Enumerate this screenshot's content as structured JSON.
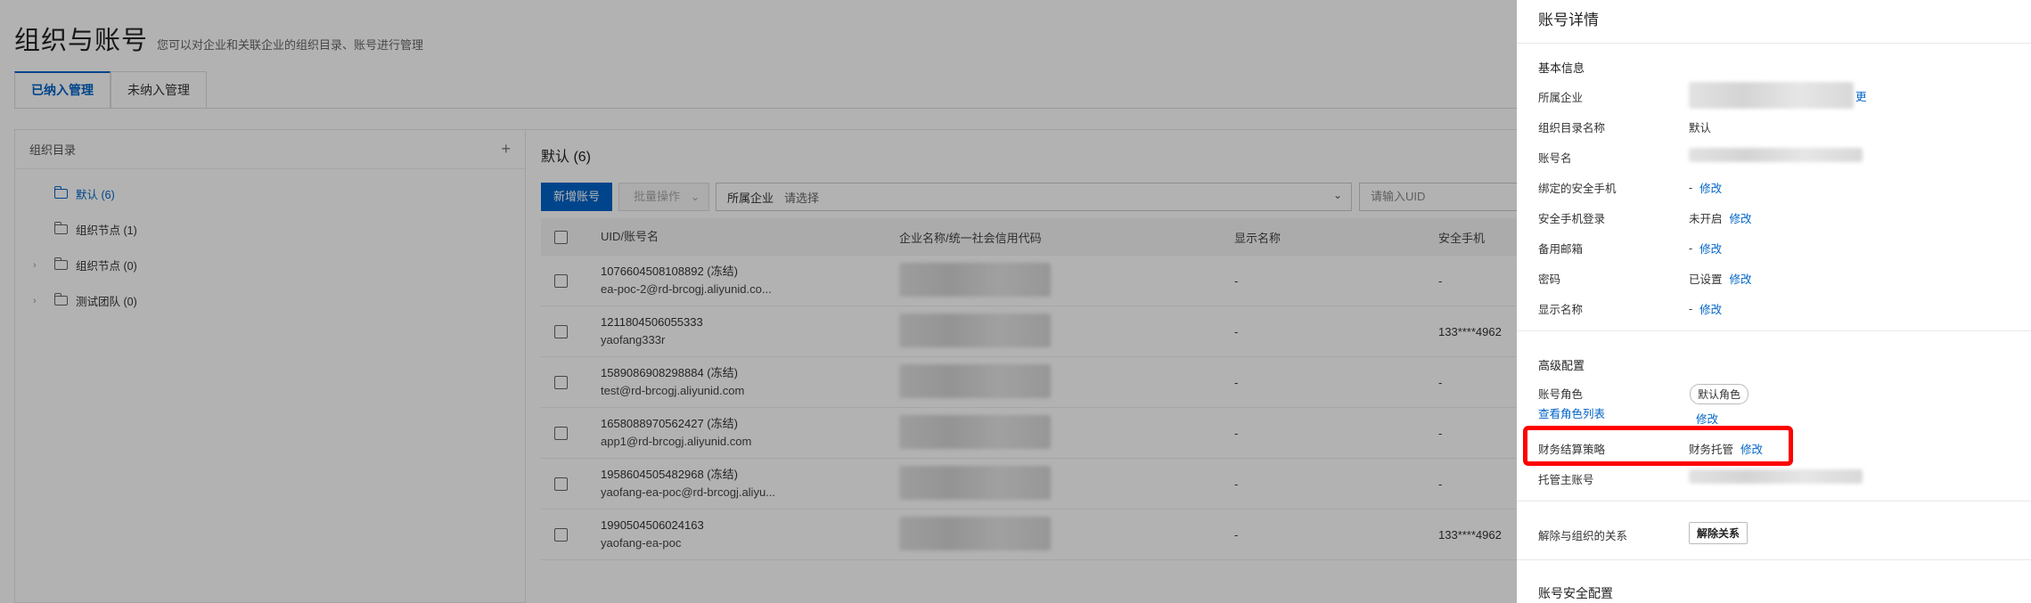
{
  "page": {
    "title": "组织与账号",
    "subtitle": "您可以对企业和关联企业的组织目录、账号进行管理",
    "tabs": [
      "已纳入管理",
      "未纳入管理"
    ]
  },
  "tree": {
    "title": "组织目录",
    "add_symbol": "+",
    "items": [
      {
        "label": "默认 (6)",
        "selected": true,
        "expandable": false
      },
      {
        "label": "组织节点 (1)",
        "selected": false,
        "expandable": false
      },
      {
        "label": "组织节点 (0)",
        "selected": false,
        "expandable": true
      },
      {
        "label": "测试团队 (0)",
        "selected": false,
        "expandable": true
      }
    ]
  },
  "main": {
    "title": "默认 (6)",
    "new_account_label": "新增账号",
    "batch_label": "批量操作",
    "enterprise_select_label": "所属企业",
    "enterprise_select_placeholder": "请选择",
    "uid_input_placeholder": "请输入UID",
    "columns": [
      "UID/账号名",
      "企业名称/统一社会信用代码",
      "显示名称",
      "安全手机"
    ],
    "rows": [
      {
        "uid": "1076604508108892 (冻结)",
        "account": "ea-poc-2@rd-brcogj.aliyunid.co...",
        "display": "-",
        "phone": "-"
      },
      {
        "uid": "1211804506055333",
        "account": "yaofang333r",
        "display": "-",
        "phone": "133****4962"
      },
      {
        "uid": "1589086908298884 (冻结)",
        "account": "test@rd-brcogj.aliyunid.com",
        "display": "-",
        "phone": "-"
      },
      {
        "uid": "1658088970562427 (冻结)",
        "account": "app1@rd-brcogj.aliyunid.com",
        "display": "-",
        "phone": "-"
      },
      {
        "uid": "1958604505482968 (冻结)",
        "account": "yaofang-ea-poc@rd-brcogj.aliyu...",
        "display": "-",
        "phone": "-"
      },
      {
        "uid": "1990504506024163",
        "account": "yaofang-ea-poc",
        "display": "-",
        "phone": "133****4962"
      }
    ]
  },
  "drawer": {
    "title": "账号详情",
    "basic_section": "基本信息",
    "advanced_section": "高级配置",
    "security_section": "账号安全配置",
    "fields": {
      "enterprise_label": "所属企业",
      "enterprise_link": "更",
      "dir_label": "组织目录名称",
      "dir_value": "默认",
      "account_label": "账号名",
      "phone_label": "绑定的安全手机",
      "phone_value": "-",
      "phone_login_label": "安全手机登录",
      "phone_login_value": "未开启",
      "email_label": "备用邮箱",
      "email_value": "-",
      "password_label": "密码",
      "password_value": "已设置",
      "display_label": "显示名称",
      "display_value": "-",
      "role_label": "账号角色",
      "role_tag": "默认角色",
      "role_list_link": "查看角色列表",
      "billing_label": "财务结算策略",
      "billing_value": "财务托管",
      "host_label": "托管主账号",
      "unlink_label": "解除与组织的关系",
      "unlink_button": "解除关系",
      "modify": "修改"
    }
  },
  "colors": {
    "accent": "#0064c8",
    "highlight": "#ff0000"
  }
}
